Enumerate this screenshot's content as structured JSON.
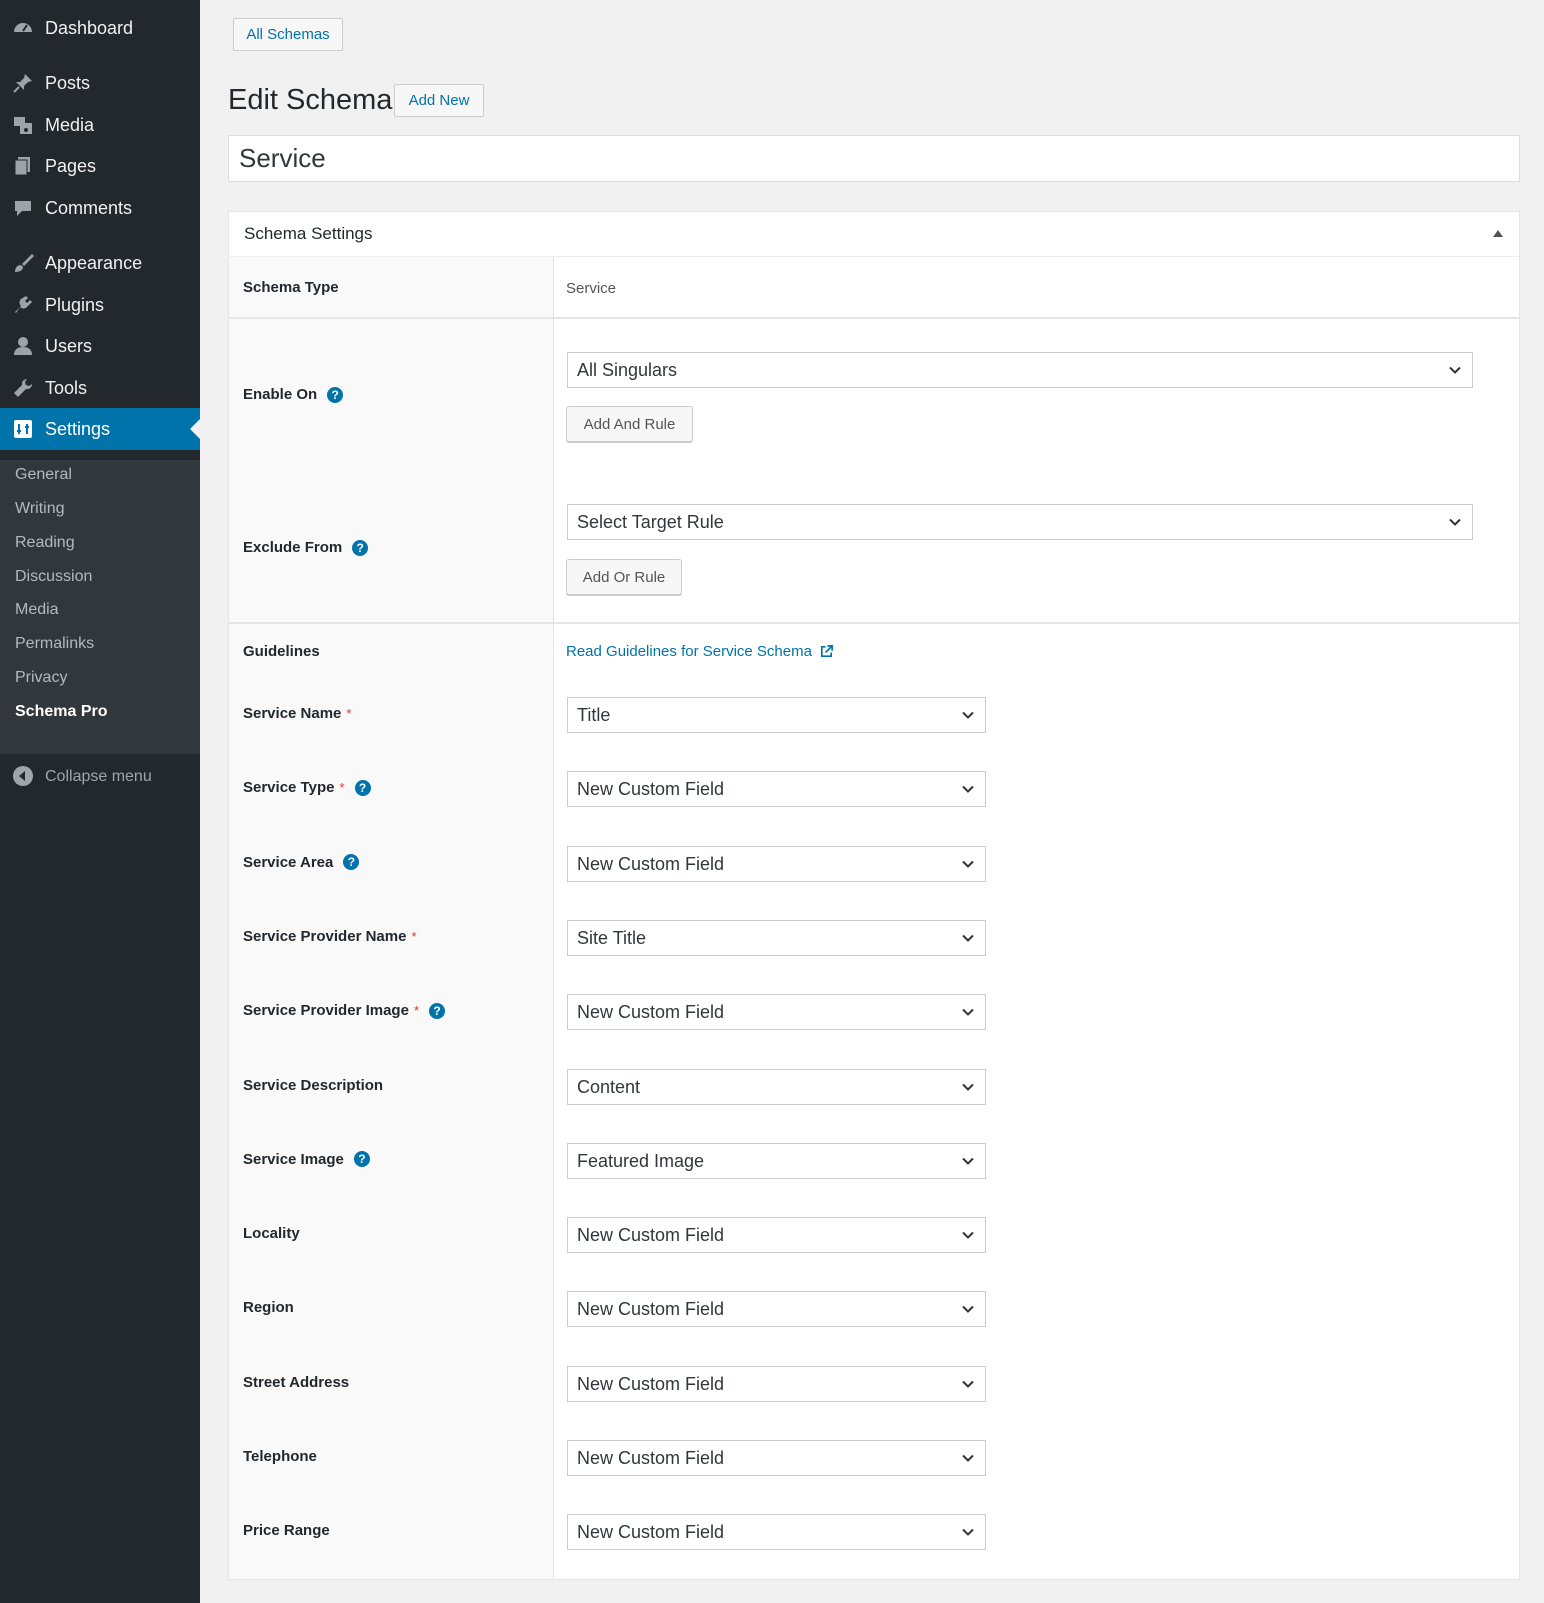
{
  "sidebar": {
    "menu": [
      {
        "label": "Dashboard",
        "icon": "dashboard-icon"
      },
      {
        "label": "Posts",
        "icon": "pin-icon"
      },
      {
        "label": "Media",
        "icon": "media-icon"
      },
      {
        "label": "Pages",
        "icon": "pages-icon"
      },
      {
        "label": "Comments",
        "icon": "comment-icon"
      },
      {
        "label": "Appearance",
        "icon": "brush-icon"
      },
      {
        "label": "Plugins",
        "icon": "plug-icon"
      },
      {
        "label": "Users",
        "icon": "user-icon"
      },
      {
        "label": "Tools",
        "icon": "wrench-icon"
      },
      {
        "label": "Settings",
        "icon": "settings-icon",
        "active": true
      }
    ],
    "submenu": [
      "General",
      "Writing",
      "Reading",
      "Discussion",
      "Media",
      "Permalinks",
      "Privacy",
      "Schema Pro"
    ],
    "submenu_current": "Schema Pro",
    "collapse_label": "Collapse menu"
  },
  "header": {
    "all_schemas_label": "All Schemas",
    "page_title": "Edit Schema",
    "add_new_label": "Add New"
  },
  "title_input": {
    "value": "Service"
  },
  "panel": {
    "title": "Schema Settings",
    "schema_type": {
      "label": "Schema Type",
      "value": "Service"
    },
    "enable_on": {
      "label": "Enable On",
      "select": "All Singulars",
      "button": "Add And Rule"
    },
    "exclude_from": {
      "label": "Exclude From",
      "select": "Select Target Rule",
      "button": "Add Or Rule"
    },
    "guidelines": {
      "label": "Guidelines",
      "link": "Read Guidelines for Service Schema"
    },
    "fields": [
      {
        "label": "Service Name",
        "required": true,
        "help": false,
        "value": "Title"
      },
      {
        "label": "Service Type",
        "required": true,
        "help": true,
        "value": "New Custom Field"
      },
      {
        "label": "Service Area",
        "required": false,
        "help": true,
        "value": "New Custom Field"
      },
      {
        "label": "Service Provider Name",
        "required": true,
        "help": false,
        "value": "Site Title"
      },
      {
        "label": "Service Provider Image",
        "required": true,
        "help": true,
        "value": "New Custom Field"
      },
      {
        "label": "Service Description",
        "required": false,
        "help": false,
        "value": "Content"
      },
      {
        "label": "Service Image",
        "required": false,
        "help": true,
        "value": "Featured Image"
      },
      {
        "label": "Locality",
        "required": false,
        "help": false,
        "value": "New Custom Field"
      },
      {
        "label": "Region",
        "required": false,
        "help": false,
        "value": "New Custom Field"
      },
      {
        "label": "Street Address",
        "required": false,
        "help": false,
        "value": "New Custom Field"
      },
      {
        "label": "Telephone",
        "required": false,
        "help": false,
        "value": "New Custom Field"
      },
      {
        "label": "Price Range",
        "required": false,
        "help": false,
        "value": "New Custom Field"
      }
    ]
  },
  "colors": {
    "sidebar_bg": "#23282d",
    "submenu_bg": "#32373c",
    "accent": "#0073aa",
    "required": "#dc3232"
  }
}
